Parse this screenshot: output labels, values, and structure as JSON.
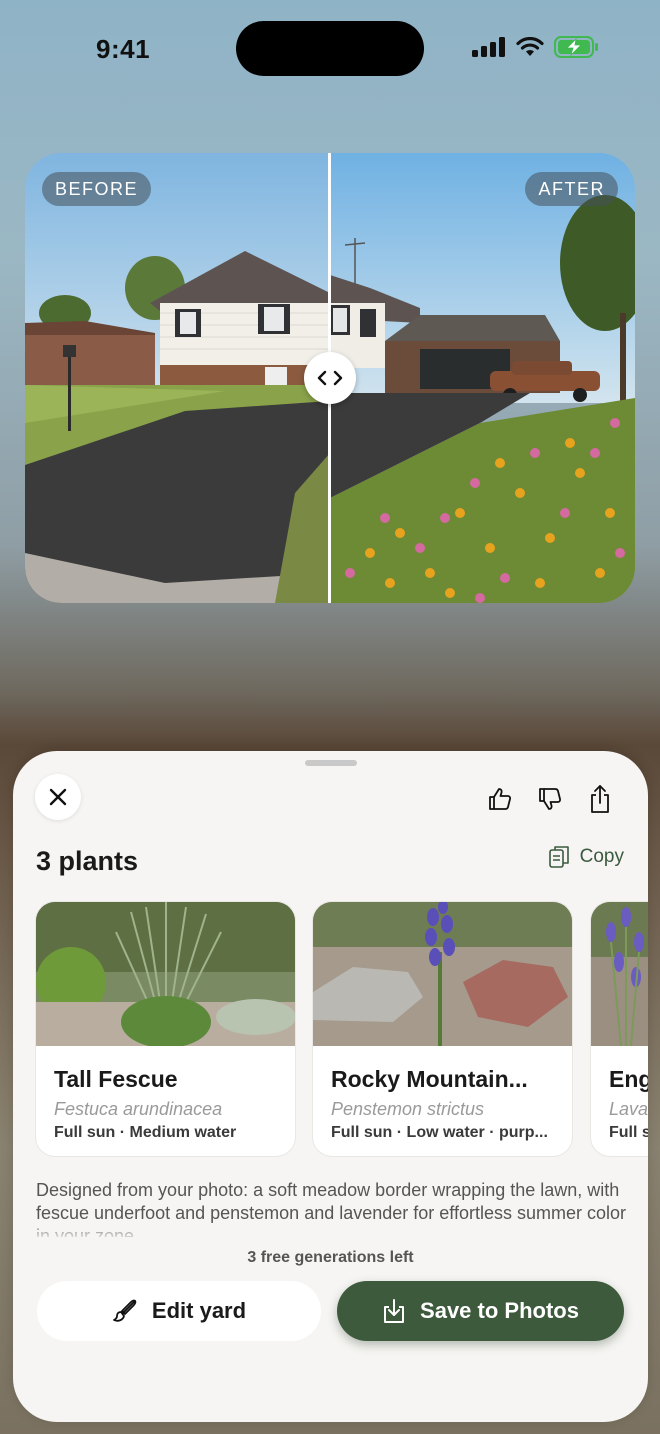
{
  "status_bar": {
    "time": "9:41"
  },
  "compare": {
    "before_label": "BEFORE",
    "after_label": "AFTER"
  },
  "sheet": {
    "title": "3 plants",
    "copy_label": "Copy",
    "plants": [
      {
        "name": "Tall Fescue",
        "scientific": "Festuca arundinacea",
        "meta": "Full sun · Medium water"
      },
      {
        "name": "Rocky Mountain...",
        "scientific": "Penstemon strictus",
        "meta": "Full sun · Low water · purp..."
      },
      {
        "name": "Eng",
        "scientific": "Lava",
        "meta": "Full s"
      }
    ],
    "description": "Designed from your photo: a soft meadow border wrapping the lawn, with fescue underfoot and penstemon and lavender for effortless summer color in your zone.",
    "free_generations": "3 free generations left",
    "edit_label": "Edit yard",
    "save_label": "Save to Photos"
  },
  "colors": {
    "accent_green": "#3e5a3c",
    "copy_green": "#3a5a3e"
  }
}
